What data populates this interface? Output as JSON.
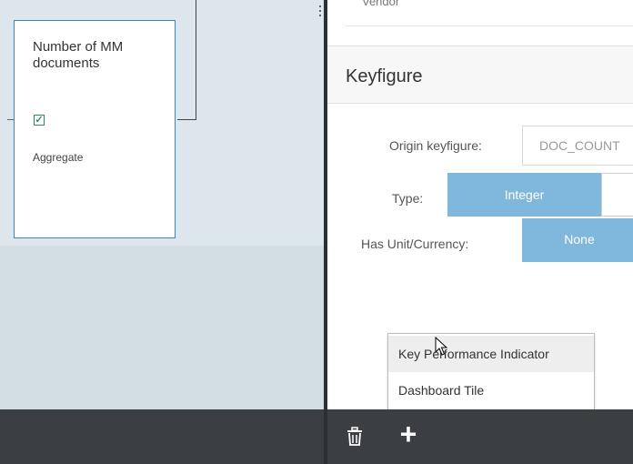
{
  "canvas": {
    "node": {
      "title": "Number of MM documents",
      "aggregate_label": "Aggregate",
      "aggregate_checked": true
    }
  },
  "panel": {
    "top_field_label": "Vendor",
    "section_title": "Keyfigure",
    "origin_keyfigure": {
      "label": "Origin keyfigure:",
      "value": "DOC_COUNT"
    },
    "type": {
      "label": "Type:",
      "selected": "Integer"
    },
    "unit_currency": {
      "label": "Has Unit/Currency:",
      "selected": "None"
    }
  },
  "add_menu": {
    "items": [
      {
        "label": "Key Performance Indicator",
        "hovered": true
      },
      {
        "label": "Dashboard Tile",
        "hovered": false
      }
    ]
  },
  "toolbar": {
    "delete_icon": "trash-icon",
    "add_icon": "plus-icon"
  },
  "colors": {
    "accent": "#7fb7dd",
    "node_border": "#3b86b8",
    "toolbar_bg": "#3b3e42"
  }
}
